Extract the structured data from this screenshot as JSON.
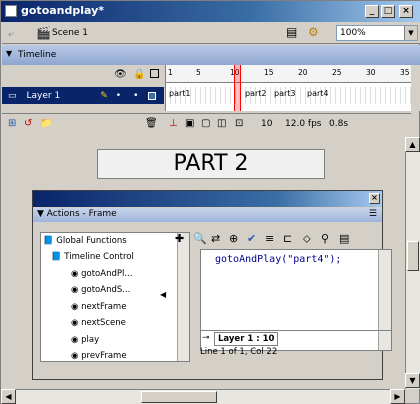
{
  "window": {
    "title": "gotoandplay*",
    "min": "_",
    "max": "□",
    "close": "×"
  },
  "scene": {
    "label": "Scene 1",
    "zoom": "100%"
  },
  "timeline": {
    "header": "Timeline",
    "layer_name": "Layer 1",
    "ruler_ticks": [
      "1",
      "5",
      "10",
      "15",
      "20",
      "25",
      "30",
      "35"
    ],
    "labels": [
      "part1",
      "part2",
      "part3",
      "part4"
    ],
    "frame": "10",
    "fps": "12.0 fps",
    "time": "0.8s"
  },
  "stage": {
    "text": "PART 2"
  },
  "actions": {
    "title": "Actions - Frame",
    "tree": [
      {
        "label": "Global Functions",
        "kind": "book"
      },
      {
        "label": "Timeline Control",
        "kind": "book"
      },
      {
        "label": "gotoAndPl...",
        "kind": "item"
      },
      {
        "label": "gotoAndS...",
        "kind": "item"
      },
      {
        "label": "nextFrame",
        "kind": "item"
      },
      {
        "label": "nextScene",
        "kind": "item"
      },
      {
        "label": "play",
        "kind": "item"
      },
      {
        "label": "prevFrame",
        "kind": "item"
      }
    ],
    "code": "gotoAndPlay(\"part4\");",
    "tab": "Layer 1 : 10",
    "status": "Line 1 of 1, Col 22"
  }
}
